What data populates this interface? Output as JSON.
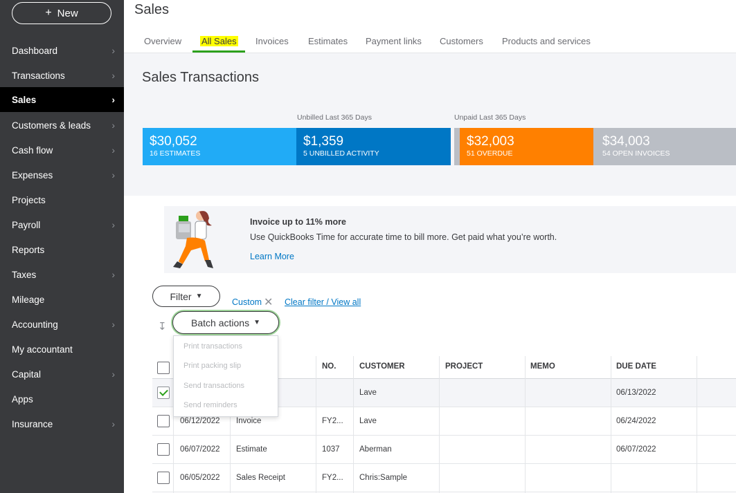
{
  "sidebar": {
    "new_button": "New",
    "items": [
      {
        "label": "Dashboard",
        "chevron": true
      },
      {
        "label": "Transactions",
        "chevron": true
      },
      {
        "label": "Sales",
        "chevron": true,
        "active": true
      },
      {
        "label": "Customers & leads",
        "chevron": true
      },
      {
        "label": "Cash flow",
        "chevron": true
      },
      {
        "label": "Expenses",
        "chevron": true
      },
      {
        "label": "Projects",
        "chevron": false
      },
      {
        "label": "Payroll",
        "chevron": true
      },
      {
        "label": "Reports",
        "chevron": false
      },
      {
        "label": "Taxes",
        "chevron": true
      },
      {
        "label": "Mileage",
        "chevron": false
      },
      {
        "label": "Accounting",
        "chevron": true
      },
      {
        "label": "My accountant",
        "chevron": false
      },
      {
        "label": "Capital",
        "chevron": true
      },
      {
        "label": "Apps",
        "chevron": false
      },
      {
        "label": "Insurance",
        "chevron": true
      }
    ]
  },
  "header": {
    "title": "Sales",
    "tabs": [
      "Overview",
      "All Sales",
      "Invoices",
      "Estimates",
      "Payment links",
      "Customers",
      "Products and services"
    ],
    "active_tab": "All Sales"
  },
  "summary": {
    "title": "Sales Transactions",
    "unbilled_label": "Unbilled Last 365 Days",
    "unpaid_label": "Unpaid Last 365 Days",
    "bars": [
      {
        "amount": "$30,052",
        "sub": "16 ESTIMATES",
        "color": "#21abf6"
      },
      {
        "amount": "$1,359",
        "sub": "5 UNBILLED ACTIVITY",
        "color": "#0077c5"
      },
      {
        "amount": "$32,003",
        "sub": "51 OVERDUE",
        "color": "#ff8000"
      },
      {
        "amount": "$34,003",
        "sub": "54 OPEN INVOICES",
        "color": "#babec5"
      }
    ]
  },
  "promo": {
    "title": "Invoice up to 11% more",
    "text": "Use QuickBooks Time for accurate time to bill more. Get paid what you’re worth.",
    "link": "Learn More"
  },
  "filters": {
    "filter_button": "Filter",
    "custom_chip": "Custom",
    "clear_link": "Clear filter / View all",
    "batch_button": "Batch actions",
    "batch_menu": [
      "Print transactions",
      "Print packing slip",
      "Send transactions",
      "Send reminders"
    ]
  },
  "table": {
    "columns": [
      "NO.",
      "CUSTOMER",
      "PROJECT",
      "MEMO",
      "DUE DATE"
    ],
    "rows": [
      {
        "date": "",
        "type": "",
        "no": "",
        "customer": "Lave",
        "project": "",
        "memo": "",
        "due": "06/13/2022",
        "checked": true
      },
      {
        "date": "06/12/2022",
        "type": "Invoice",
        "no": "FY2...",
        "customer": "Lave",
        "project": "",
        "memo": "",
        "due": "06/24/2022",
        "checked": false
      },
      {
        "date": "06/07/2022",
        "type": "Estimate",
        "no": "1037",
        "customer": "Aberman",
        "project": "",
        "memo": "",
        "due": "06/07/2022",
        "checked": false
      },
      {
        "date": "06/05/2022",
        "type": "Sales Receipt",
        "no": "FY2...",
        "customer": "Chris:Sample",
        "project": "",
        "memo": "",
        "due": "",
        "checked": false
      }
    ]
  },
  "colors": {
    "sidebar_bg": "#393a3d",
    "active_nav": "#000000",
    "accent_green": "#2ca01c",
    "link_blue": "#0077c5",
    "tab_highlight": "#ffff00"
  }
}
